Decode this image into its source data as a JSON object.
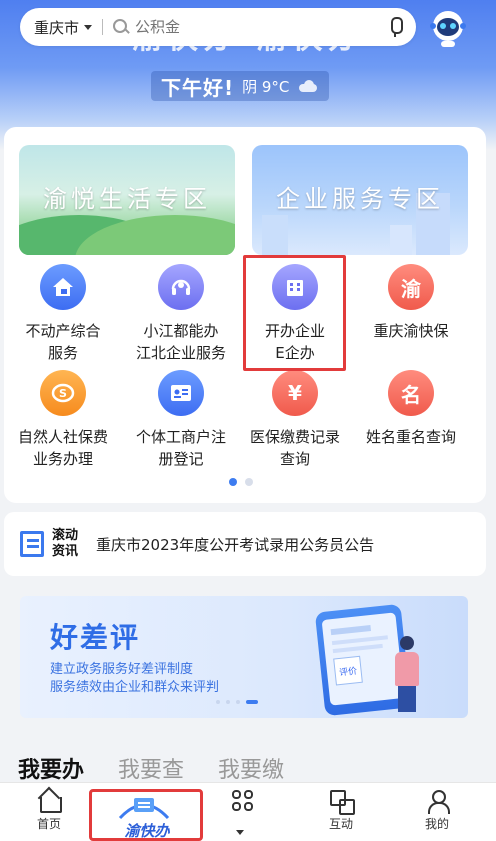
{
  "header": {
    "banner_text": "渝快办 渝快办",
    "greeting": "下午好!",
    "weather": "阴 9°C"
  },
  "search": {
    "city": "重庆市",
    "placeholder": "公积金"
  },
  "zones": {
    "life": "渝悦生活专区",
    "business": "企业服务专区"
  },
  "services": [
    {
      "label": "不动产综合服务",
      "icon": "house-icon",
      "color": "#3d6df2"
    },
    {
      "label": "小江都能办江北企业服务",
      "icon": "headset-icon",
      "color": "#6c6ff0"
    },
    {
      "label": "开办企业E企办",
      "icon": "building-icon",
      "color": "#6c6ff0"
    },
    {
      "label": "重庆渝快保",
      "icon": "yu-icon",
      "color": "#f05a4c"
    },
    {
      "label": "自然人社保费业务办理",
      "icon": "social-security-icon",
      "color": "#f68b1e"
    },
    {
      "label": "个体工商户注册登记",
      "icon": "id-card-icon",
      "color": "#3d6df2"
    },
    {
      "label": "医保缴费记录查询",
      "icon": "yuan-doc-icon",
      "color": "#f05a4c"
    },
    {
      "label": "姓名重名查询",
      "icon": "name-icon",
      "color": "#f05a4c"
    }
  ],
  "service_lines": {
    "s0": [
      "不动产综合",
      "服务"
    ],
    "s1": [
      "小江都能办",
      "江北企业服务"
    ],
    "s2": [
      "开办企业",
      "E企办"
    ],
    "s3": [
      "重庆渝快保"
    ],
    "s4": [
      "自然人社保费",
      "业务办理"
    ],
    "s5": [
      "个体工商户注",
      "册登记"
    ],
    "s6": [
      "医保缴费记录",
      "查询"
    ],
    "s7": [
      "姓名重名查询"
    ]
  },
  "icon_glyphs": {
    "s3": "渝",
    "s6": "¥",
    "s7": "名"
  },
  "news": {
    "tag_line1": "滚动",
    "tag_line2": "资讯",
    "text": "重庆市2023年度公开考试录用公务员公告"
  },
  "evaluation": {
    "title": "好差评",
    "line1": "建立政务服务好差评制度",
    "line2": "服务绩效由企业和群众来评判",
    "phone_label": "评价"
  },
  "tabs": [
    "我要办",
    "我要查",
    "我要缴"
  ],
  "nav": {
    "home": "首页",
    "center": "渝快办",
    "interact": "互动",
    "mine": "我的"
  },
  "colors": {
    "accent": "#3d7cf0",
    "highlight": "#e23b3b"
  }
}
